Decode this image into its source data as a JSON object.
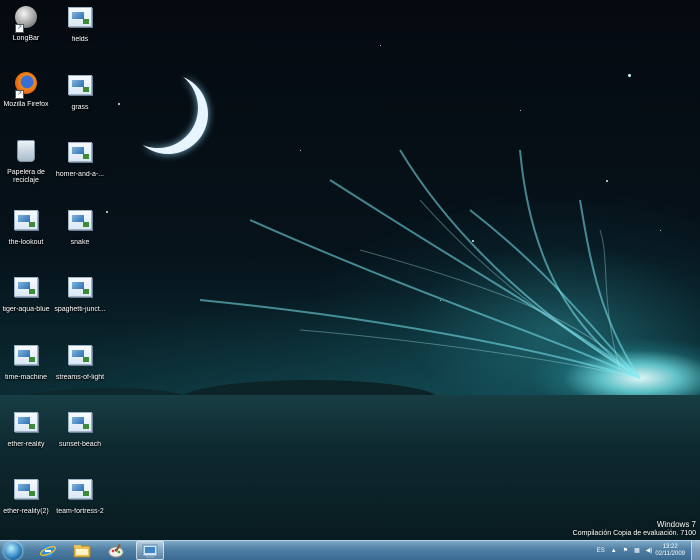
{
  "desktop_icons": [
    {
      "label": "LongBar",
      "kind": "round"
    },
    {
      "label": "Mozilla Firefox",
      "kind": "firefox"
    },
    {
      "label": "Papelera de reciclaje",
      "kind": "bin"
    },
    {
      "label": "the-lookout",
      "kind": "file"
    },
    {
      "label": "tiger-aqua-blue",
      "kind": "file"
    },
    {
      "label": "time-machine",
      "kind": "file"
    },
    {
      "label": "ether-reality",
      "kind": "file"
    },
    {
      "label": "ether-reality(2)",
      "kind": "file"
    },
    {
      "label": "fields",
      "kind": "file"
    },
    {
      "label": "grass",
      "kind": "file"
    },
    {
      "label": "homer-and-a-...",
      "kind": "file"
    },
    {
      "label": "snake",
      "kind": "file"
    },
    {
      "label": "spaghetti-junct...",
      "kind": "file"
    },
    {
      "label": "streams-of-light",
      "kind": "file"
    },
    {
      "label": "sunset-beach",
      "kind": "file"
    },
    {
      "label": "team-fortress-2",
      "kind": "file"
    }
  ],
  "watermark": {
    "line1": "Windows 7",
    "line2": "Compilación Copia de evaluación. 7100"
  },
  "taskbar": {
    "pinned": [
      "internet-explorer-icon",
      "folder-icon",
      "paint-icon",
      "control-panel-icon"
    ],
    "tray": {
      "language": "ES",
      "time": "13:22",
      "date": "02/11/2009"
    }
  }
}
